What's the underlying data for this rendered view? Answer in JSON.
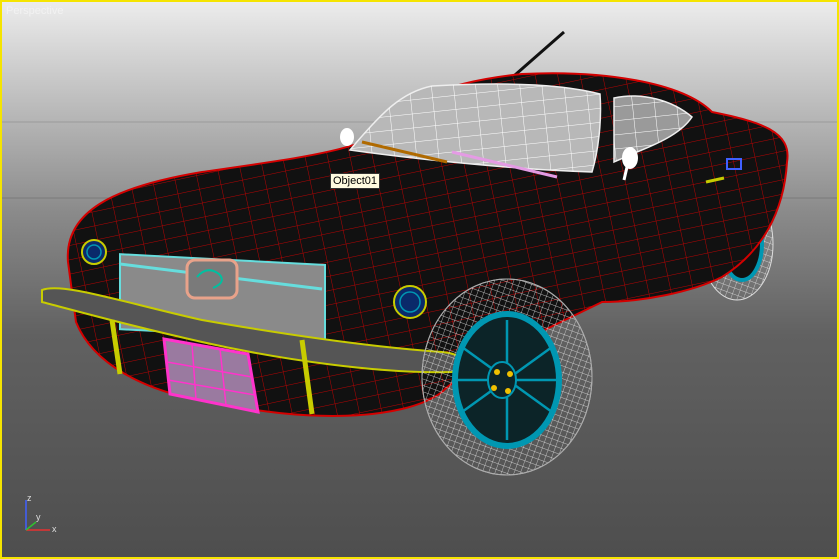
{
  "viewport": {
    "label": "Perspective",
    "active_border_color": "#f5e400"
  },
  "scene": {
    "object_tooltip": "Object01",
    "wire_color_body": "#d40000",
    "wire_color_bumper": "#c8cc00",
    "wire_color_wheels": "#0097b2",
    "wire_color_plate": "#ff33cc",
    "wire_color_trim": "#66dddd"
  },
  "axis_tripod": {
    "x_label": "x",
    "y_label": "y",
    "z_label": "z",
    "x_color": "#e83030",
    "y_color": "#30c030",
    "z_color": "#4060ff"
  }
}
